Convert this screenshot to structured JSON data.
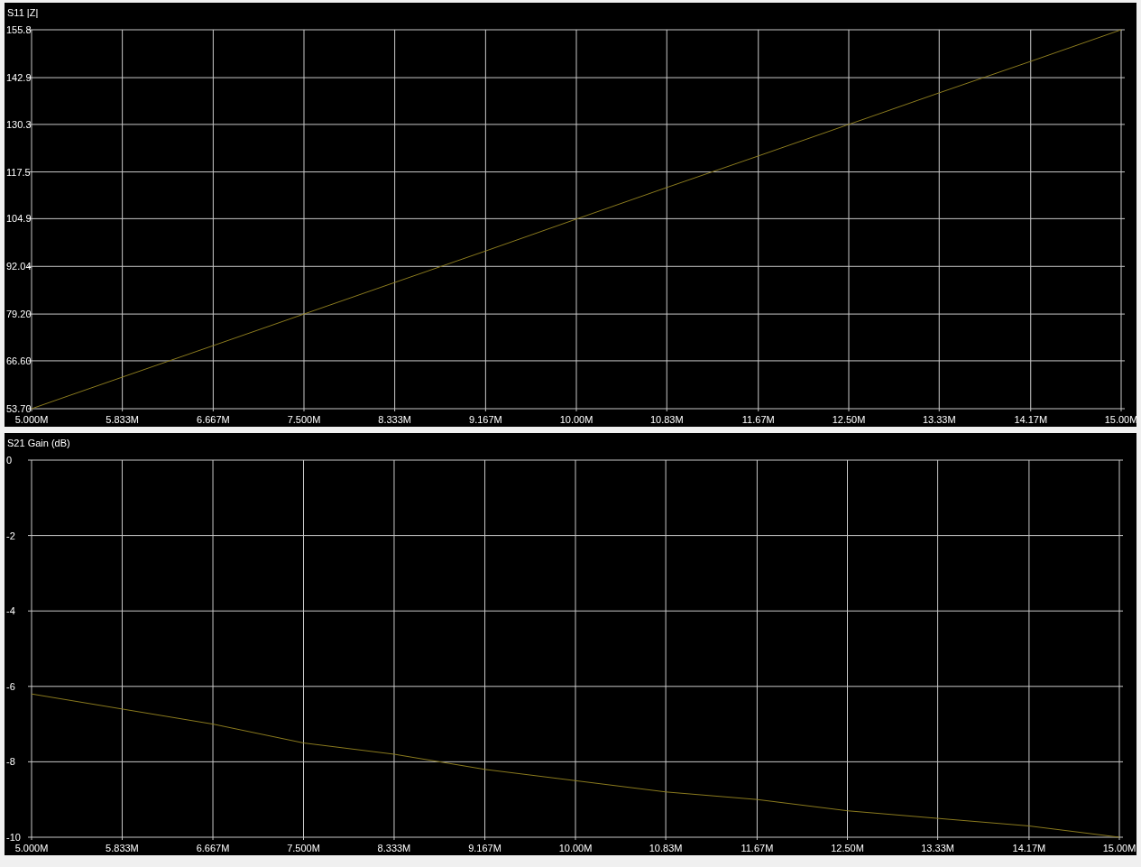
{
  "charts": [
    {
      "chart_data": {
        "type": "line",
        "title": "S11 |Z|",
        "grid": true,
        "x": [
          5,
          5.833,
          6.667,
          7.5,
          8.333,
          9.167,
          10,
          10.83,
          11.67,
          12.5,
          13.33,
          14.17,
          15
        ],
        "series": [
          {
            "color": "#8a7a1e",
            "values": [
              53.7,
              62.2,
              70.7,
              79.2,
              87.7,
              96.2,
              104.8,
              113.3,
              121.8,
              130.3,
              138.8,
              147.3,
              155.8
            ]
          }
        ],
        "xlim": [
          5,
          15
        ],
        "ylim": [
          53.7,
          155.8
        ],
        "xticks": [
          {
            "value": 5,
            "label": "5.000M"
          },
          {
            "value": 5.833,
            "label": "5.833M"
          },
          {
            "value": 6.667,
            "label": "6.667M"
          },
          {
            "value": 7.5,
            "label": "7.500M"
          },
          {
            "value": 8.333,
            "label": "8.333M"
          },
          {
            "value": 9.167,
            "label": "9.167M"
          },
          {
            "value": 10,
            "label": "10.00M"
          },
          {
            "value": 10.83,
            "label": "10.83M"
          },
          {
            "value": 11.67,
            "label": "11.67M"
          },
          {
            "value": 12.5,
            "label": "12.50M"
          },
          {
            "value": 13.33,
            "label": "13.33M"
          },
          {
            "value": 14.17,
            "label": "14.17M"
          },
          {
            "value": 15,
            "label": "15.00M"
          }
        ],
        "yticks": [
          {
            "value": 155.8,
            "label": "155.8"
          },
          {
            "value": 142.9,
            "label": "142.9"
          },
          {
            "value": 130.3,
            "label": "130.3"
          },
          {
            "value": 117.5,
            "label": "117.5"
          },
          {
            "value": 104.9,
            "label": "104.9"
          },
          {
            "value": 92.04,
            "label": "92.04"
          },
          {
            "value": 79.2,
            "label": "79.20"
          },
          {
            "value": 66.6,
            "label": "66.60"
          },
          {
            "value": 53.7,
            "label": "53.70"
          }
        ]
      }
    },
    {
      "chart_data": {
        "type": "line",
        "title": "S21 Gain (dB)",
        "grid": true,
        "x": [
          5,
          5.833,
          6.667,
          7.5,
          8.333,
          9.167,
          10,
          10.83,
          11.67,
          12.5,
          13.33,
          14.17,
          15
        ],
        "series": [
          {
            "color": "#8a7a1e",
            "values": [
              -6.2,
              -6.6,
              -7.0,
              -7.5,
              -7.8,
              -8.2,
              -8.5,
              -8.8,
              -9.0,
              -9.3,
              -9.5,
              -9.7,
              -10.0
            ]
          }
        ],
        "xlim": [
          5,
          15
        ],
        "ylim": [
          -10,
          0
        ],
        "xticks": [
          {
            "value": 5,
            "label": "5.000M"
          },
          {
            "value": 5.833,
            "label": "5.833M"
          },
          {
            "value": 6.667,
            "label": "6.667M"
          },
          {
            "value": 7.5,
            "label": "7.500M"
          },
          {
            "value": 8.333,
            "label": "8.333M"
          },
          {
            "value": 9.167,
            "label": "9.167M"
          },
          {
            "value": 10,
            "label": "10.00M"
          },
          {
            "value": 10.83,
            "label": "10.83M"
          },
          {
            "value": 11.67,
            "label": "11.67M"
          },
          {
            "value": 12.5,
            "label": "12.50M"
          },
          {
            "value": 13.33,
            "label": "13.33M"
          },
          {
            "value": 14.17,
            "label": "14.17M"
          },
          {
            "value": 15,
            "label": "15.00M"
          }
        ],
        "yticks": [
          0,
          -2,
          -4,
          -6,
          -8,
          -10
        ]
      }
    }
  ]
}
